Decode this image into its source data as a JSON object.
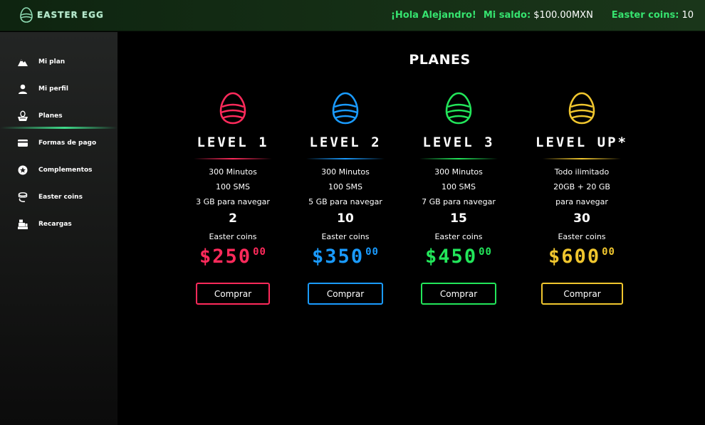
{
  "brand": {
    "name": "EASTER EGG",
    "icon": "egg-icon",
    "color": "#b8e6cc"
  },
  "header": {
    "greeting": "¡Hola Alejandro!",
    "balance_label": "Mi saldo:",
    "balance_value": "$100.00MXN",
    "coins_label": "Easter coins:",
    "coins_value": "10",
    "accent": "#36e36f"
  },
  "sidebar": {
    "items": [
      {
        "label": "Mi plan",
        "icon": "mountain-icon"
      },
      {
        "label": "Mi perfil",
        "icon": "user-icon"
      },
      {
        "label": "Planes",
        "icon": "egg-basket-icon",
        "active": true
      },
      {
        "label": "Formas de pago",
        "icon": "credit-card-icon"
      },
      {
        "label": "Complementos",
        "icon": "badge-star-icon"
      },
      {
        "label": "Easter coins",
        "icon": "coins-icon"
      },
      {
        "label": "Recargas",
        "icon": "cash-register-icon"
      }
    ]
  },
  "page": {
    "title": "PLANES"
  },
  "plans": [
    {
      "name": "LEVEL 1",
      "color": "#ff2a5b",
      "features": [
        "300 Minutos",
        "100 SMS",
        "3 GB para navegar"
      ],
      "coins": "2",
      "coins_label": "Easter coins",
      "price": "$250",
      "cents": "00",
      "button": "Comprar"
    },
    {
      "name": "LEVEL 2",
      "color": "#1a9bff",
      "features": [
        "300 Minutos",
        "100 SMS",
        "5 GB para navegar"
      ],
      "coins": "10",
      "coins_label": "Easter coins",
      "price": "$350",
      "cents": "00",
      "button": "Comprar"
    },
    {
      "name": "LEVEL 3",
      "color": "#22e65a",
      "features": [
        "300 Minutos",
        "100 SMS",
        "7 GB para navegar"
      ],
      "coins": "15",
      "coins_label": "Easter coins",
      "price": "$450",
      "cents": "00",
      "button": "Comprar"
    },
    {
      "name": "LEVEL UP*",
      "color": "#f0c62e",
      "features": [
        "Todo ilimitado",
        "20GB + 20 GB",
        "para navegar"
      ],
      "coins": "30",
      "coins_label": "Easter coins",
      "price": "$600",
      "cents": "00",
      "button": "Comprar"
    }
  ]
}
